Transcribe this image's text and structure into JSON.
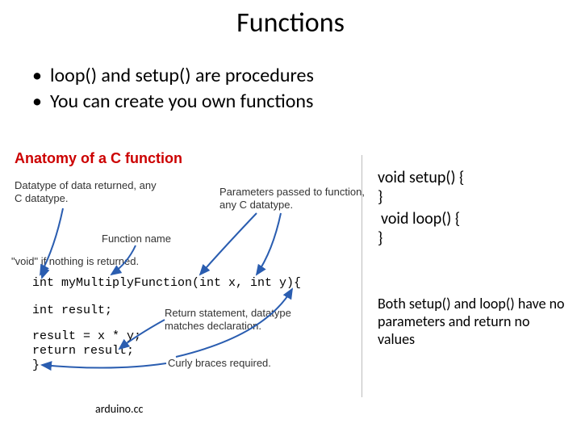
{
  "title": "Functions",
  "bullets": {
    "b1": "loop() and setup() are procedures",
    "b2": "You can create you own functions"
  },
  "diagram": {
    "heading": "Anatomy of a C function",
    "returntype": "Datatype of data returned, any C datatype.",
    "void": "\"void\" if nothing is returned.",
    "fname": "Function name",
    "params": "Parameters passed to function, any C datatype.",
    "sig": "int myMultiplyFunction(int x, int y){",
    "body1": "int result;",
    "body2": "result = x * y;",
    "body3": "return result;",
    "body4": "}",
    "returnstmt": "Return statement, datatype matches declaration.",
    "curly": "Curly braces required."
  },
  "sidecode": {
    "l1": "void setup() {",
    "l2": "}",
    "l3": "void loop() {",
    "l4": "}"
  },
  "sidetext": "Both setup() and loop() have no parameters and return no values",
  "attribution": "arduino.cc"
}
